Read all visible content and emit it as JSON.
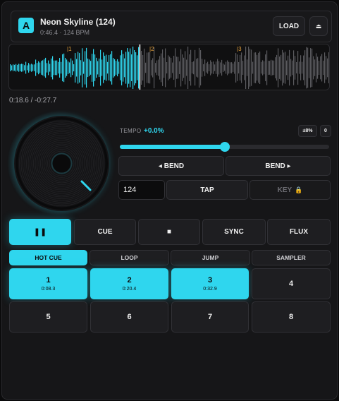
{
  "header": {
    "deck_letter": "A",
    "title": "Neon Skyline (124)",
    "meta": "0:46.4 · 124 BPM",
    "load_label": "LOAD",
    "eject_icon": "⏏"
  },
  "waveform": {
    "cue_markers": [
      "1",
      "2",
      "3"
    ],
    "played_fraction": 0.405
  },
  "time": {
    "readout": "0:18.6 / -0:27.7"
  },
  "tempo": {
    "label": "TEMPO",
    "value": "+0.0%",
    "range_label": "±8%",
    "reset_label": "0",
    "slider_fraction": 0.5
  },
  "bend": {
    "left_label": "◂ BEND",
    "right_label": "BEND ▸"
  },
  "bpm": {
    "value": "124"
  },
  "tap_label": "TAP",
  "key": {
    "label": "KEY",
    "lock_icon": "🔒"
  },
  "transport": {
    "play_icon": "❚❚",
    "cue_label": "CUE",
    "stop_icon": "■",
    "sync_label": "SYNC",
    "flux_label": "FLUX"
  },
  "tabs": [
    "HOT CUE",
    "LOOP",
    "JUMP",
    "SAMPLER"
  ],
  "pads": [
    {
      "number": "1",
      "time": "0:08.3"
    },
    {
      "number": "2",
      "time": "0:20.4"
    },
    {
      "number": "3",
      "time": "0:32.9"
    },
    {
      "number": "4",
      "time": ""
    },
    {
      "number": "5",
      "time": ""
    },
    {
      "number": "6",
      "time": ""
    },
    {
      "number": "7",
      "time": ""
    },
    {
      "number": "8",
      "time": ""
    }
  ],
  "colors": {
    "accent": "#2fd6ee",
    "cue_marker": "#e6a23c",
    "unplayed_wave": "#5a5a5e"
  }
}
